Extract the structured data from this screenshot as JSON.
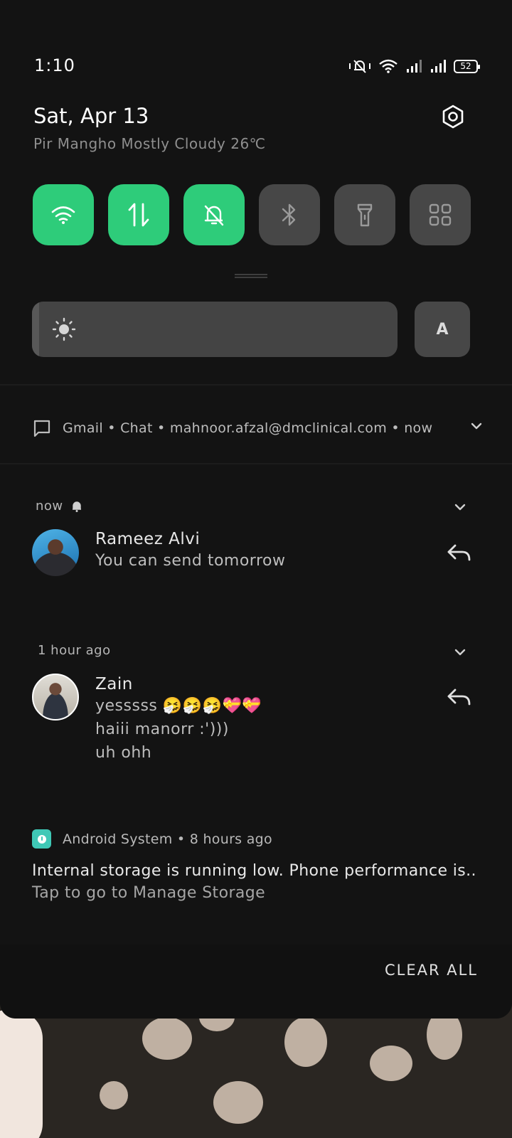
{
  "status_bar": {
    "time": "1:10",
    "battery": "52"
  },
  "header": {
    "date": "Sat, Apr 13",
    "weather": "Pir Mangho Mostly Cloudy 26℃"
  },
  "quick_tiles": [
    {
      "name": "wifi",
      "icon": "wifi-icon",
      "active": true
    },
    {
      "name": "mobile-data",
      "icon": "data-arrows-icon",
      "active": true
    },
    {
      "name": "mute",
      "icon": "bell-off-icon",
      "active": true
    },
    {
      "name": "bluetooth",
      "icon": "bluetooth-icon",
      "active": false
    },
    {
      "name": "flashlight",
      "icon": "flashlight-icon",
      "active": false
    },
    {
      "name": "more",
      "icon": "grid-icon",
      "active": false
    }
  ],
  "brightness": {
    "level": 0.02,
    "auto_label": "A"
  },
  "gmail_summary": {
    "text": "Gmail • Chat • mahnoor.afzal@dmclinical.com • now"
  },
  "notifications": [
    {
      "time": "now",
      "sender": "Rameez Alvi",
      "lines": [
        "You can send tomorrow"
      ]
    },
    {
      "time": "1 hour ago",
      "sender": "Zain",
      "lines": [
        "yesssss 🤧🤧🤧💝💝",
        "haiii manorr :')))",
        "uh ohh"
      ]
    }
  ],
  "android_system": {
    "header": "Android System • 8 hours ago",
    "title": "Internal storage is running low. Phone performance is..",
    "subtitle": "Tap to go to Manage Storage"
  },
  "footer": {
    "clear_all": "CLEAR ALL"
  },
  "colors": {
    "tile_active": "#2ecc7a",
    "tile_inactive": "#474747",
    "background": "#131313"
  }
}
